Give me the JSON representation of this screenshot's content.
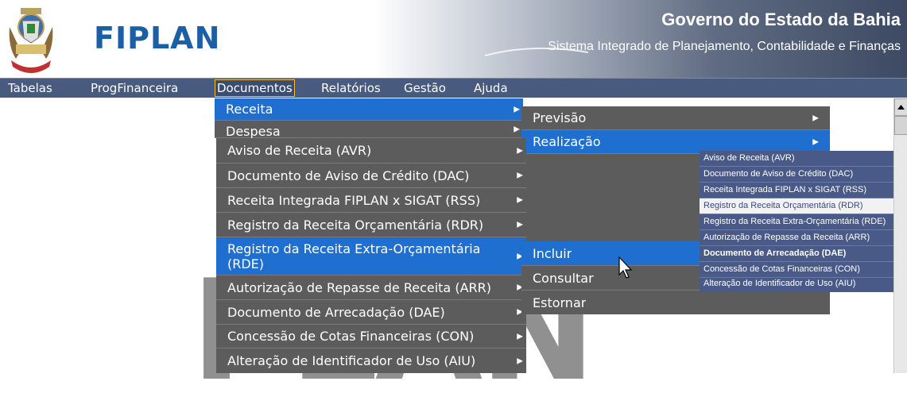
{
  "header": {
    "logo_text": "FIPLAN",
    "title": "Governo do Estado da Bahia",
    "subtitle": "Sistema Integrado de Planejamento, Contabilidade e Finanças"
  },
  "menubar": {
    "items": [
      {
        "label": "Tabelas"
      },
      {
        "label": "ProgFinanceira"
      },
      {
        "label": "Documentos"
      },
      {
        "label": "Relatórios"
      },
      {
        "label": "Gestão"
      },
      {
        "label": "Ajuda"
      }
    ]
  },
  "menu_documentos": {
    "items": [
      {
        "label": "Receita",
        "selected": true
      },
      {
        "label": "Despesa"
      }
    ]
  },
  "menu_receita": {
    "items": [
      {
        "label": "Previsão"
      },
      {
        "label": "Realização",
        "selected": true
      }
    ]
  },
  "menu_aviso": {
    "items": [
      {
        "label": "Aviso de Receita (AVR)"
      },
      {
        "label": "Documento de Aviso de Crédito (DAC)"
      },
      {
        "label": "Receita Integrada FIPLAN x SIGAT (RSS)"
      },
      {
        "label": "Registro da Receita Orçamentária (RDR)"
      },
      {
        "label": "Registro da Receita Extra-Orçamentária (RDE)",
        "selected": true
      },
      {
        "label": "Autorização de Repasse de Receita (ARR)"
      },
      {
        "label": "Documento de Arrecadação (DAE)"
      },
      {
        "label": "Concessão de Cotas Financeiras (CON)"
      },
      {
        "label": "Alteração de Identificador de Uso (AIU)"
      }
    ]
  },
  "menu_acoes": {
    "items": [
      {
        "label": "Incluir",
        "selected": true
      },
      {
        "label": "Consultar"
      },
      {
        "label": "Estornar"
      }
    ]
  },
  "menu_realizacao": {
    "items": [
      {
        "label": "Aviso de Receita (AVR)"
      },
      {
        "label": "Documento de Aviso de Crédito (DAC)"
      },
      {
        "label": "Receita Integrada FIPLAN x SIGAT (RSS)"
      },
      {
        "label": "Registro da Receita Orçamentária (RDR)",
        "highlighted": true
      },
      {
        "label": "Registro da Receita Extra-Orçamentária (RDE)"
      },
      {
        "label": "Autorização de Repasse da Receita (ARR)"
      },
      {
        "label": "Documento de Arrecadação (DAE)",
        "bold": true
      },
      {
        "label": "Concessão de Cotas Financeiras (CON)"
      },
      {
        "label": "Alteração de Identificador de Uso (AIU)"
      }
    ]
  },
  "watermark_text": "PLAN",
  "colors": {
    "menubar": "#485a7e",
    "menu_bg": "#5c5c5c",
    "selected": "#1f6fd0",
    "small_menu_bg": "#4a5a88",
    "logo": "#1b5fa6"
  }
}
